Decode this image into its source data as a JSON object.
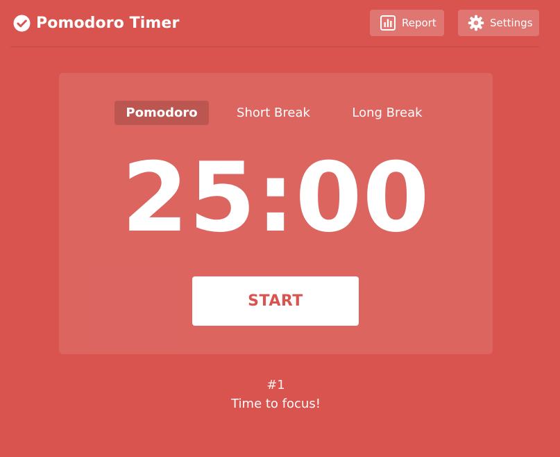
{
  "app": {
    "title": "Pomodoro Timer",
    "background_color": "#d9544f",
    "logo_icon": "check-circle-icon"
  },
  "header": {
    "report_label": "Report",
    "report_icon": "bar-chart-icon",
    "settings_label": "Settings",
    "settings_icon": "gear-icon"
  },
  "timer": {
    "tabs": [
      {
        "label": "Pomodoro",
        "selected": true
      },
      {
        "label": "Short Break",
        "selected": false
      },
      {
        "label": "Long Break",
        "selected": false
      }
    ],
    "time": "25:00",
    "start_label": "START"
  },
  "session": {
    "count": "#1",
    "message": "Time to focus!"
  }
}
